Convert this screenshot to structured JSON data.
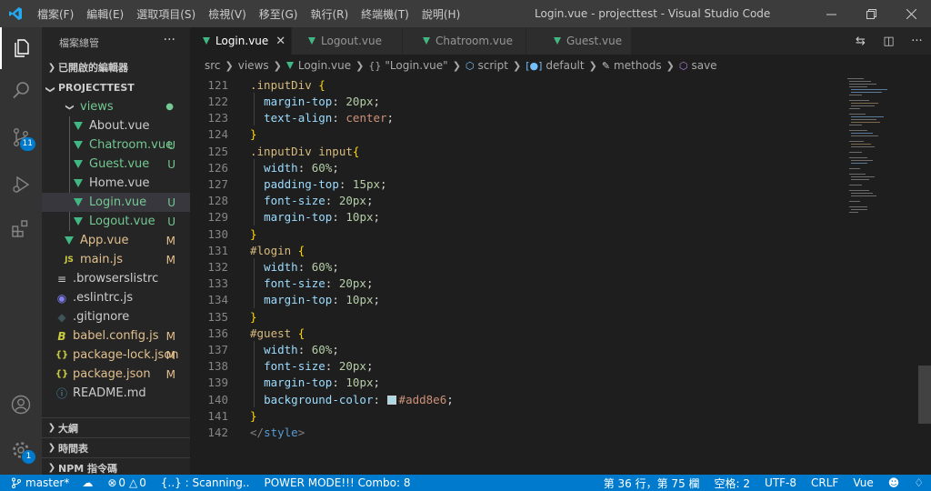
{
  "titlebar": {
    "menus": [
      "檔案(F)",
      "編輯(E)",
      "選取項目(S)",
      "檢視(V)",
      "移至(G)",
      "執行(R)",
      "終端機(T)",
      "說明(H)"
    ],
    "window_title": "Login.vue - projecttest - Visual Studio Code"
  },
  "activity": {
    "scm_badge": "11",
    "manage_badge": "1"
  },
  "sidebar": {
    "title": "檔案總管",
    "open_editors": "已開啟的編輯器",
    "project": "PROJECTTEST",
    "folder": "views",
    "files": [
      {
        "name": "About.vue",
        "status": ""
      },
      {
        "name": "Chatroom.vue",
        "status": "U"
      },
      {
        "name": "Guest.vue",
        "status": "U"
      },
      {
        "name": "Home.vue",
        "status": ""
      },
      {
        "name": "Login.vue",
        "status": "U"
      },
      {
        "name": "Logout.vue",
        "status": "U"
      }
    ],
    "root_files": [
      {
        "name": "App.vue",
        "status": "M",
        "icon": "vue"
      },
      {
        "name": "main.js",
        "status": "M",
        "icon": "JS"
      },
      {
        "name": ".browserslistrc",
        "status": "",
        "icon": "lines"
      },
      {
        "name": ".eslintrc.js",
        "status": "",
        "icon": "eslint"
      },
      {
        "name": ".gitignore",
        "status": "",
        "icon": "git"
      },
      {
        "name": "babel.config.js",
        "status": "M",
        "icon": "babel"
      },
      {
        "name": "package-lock.json",
        "status": "M",
        "icon": "{}"
      },
      {
        "name": "package.json",
        "status": "M",
        "icon": "{}"
      },
      {
        "name": "README.md",
        "status": "",
        "icon": "info"
      }
    ],
    "outline": "大綱",
    "timeline": "時間表",
    "npm": "NPM 指令碼"
  },
  "tabs": [
    {
      "label": "Login.vue",
      "active": true
    },
    {
      "label": "Logout.vue",
      "active": false
    },
    {
      "label": "Chatroom.vue",
      "active": false
    },
    {
      "label": "Guest.vue",
      "active": false
    }
  ],
  "breadcrumb": {
    "src": "src",
    "views": "views",
    "file": "Login.vue",
    "braces": "{}",
    "quoted": "\"Login.vue\"",
    "script": "script",
    "default": "default",
    "methods": "methods",
    "save": "save"
  },
  "code": {
    "line_numbers": [
      "121",
      "122",
      "123",
      "124",
      "125",
      "126",
      "127",
      "128",
      "129",
      "130",
      "131",
      "132",
      "133",
      "134",
      "135",
      "136",
      "137",
      "138",
      "139",
      "140",
      "141",
      "142"
    ],
    "l121": ".inputDiv",
    "l122p": "margin-top",
    "l122v": "20px",
    "l123p": "text-align",
    "l123v": "center",
    "l125s": ".inputDiv input",
    "l126p": "width",
    "l126v": "60%",
    "l127p": "padding-top",
    "l127v": "15px",
    "l128p": "font-size",
    "l128v": "20px",
    "l129p": "margin-top",
    "l129v": "10px",
    "l131": "#login",
    "l132p": "width",
    "l132v": "60%",
    "l133p": "font-size",
    "l133v": "20px",
    "l134p": "margin-top",
    "l134v": "10px",
    "l136": "#guest",
    "l137p": "width",
    "l137v": "60%",
    "l138p": "font-size",
    "l138v": "20px",
    "l139p": "margin-top",
    "l139v": "10px",
    "l140p": "background-color",
    "l140v": "#add8e6",
    "l142": "style"
  },
  "status": {
    "branch": "master*",
    "errors": "0",
    "warnings": "0",
    "scanning": "{..} : Scanning..",
    "power": "POWER MODE!!! Combo: 8",
    "position": "第 36 行，第 75 欄",
    "spaces": "空格: 2",
    "encoding": "UTF-8",
    "eol": "CRLF",
    "language": "Vue"
  },
  "colors": {
    "accent": "#007acc",
    "vue_green": "#41b883",
    "untracked": "#73c991",
    "modified": "#e2c08d"
  }
}
